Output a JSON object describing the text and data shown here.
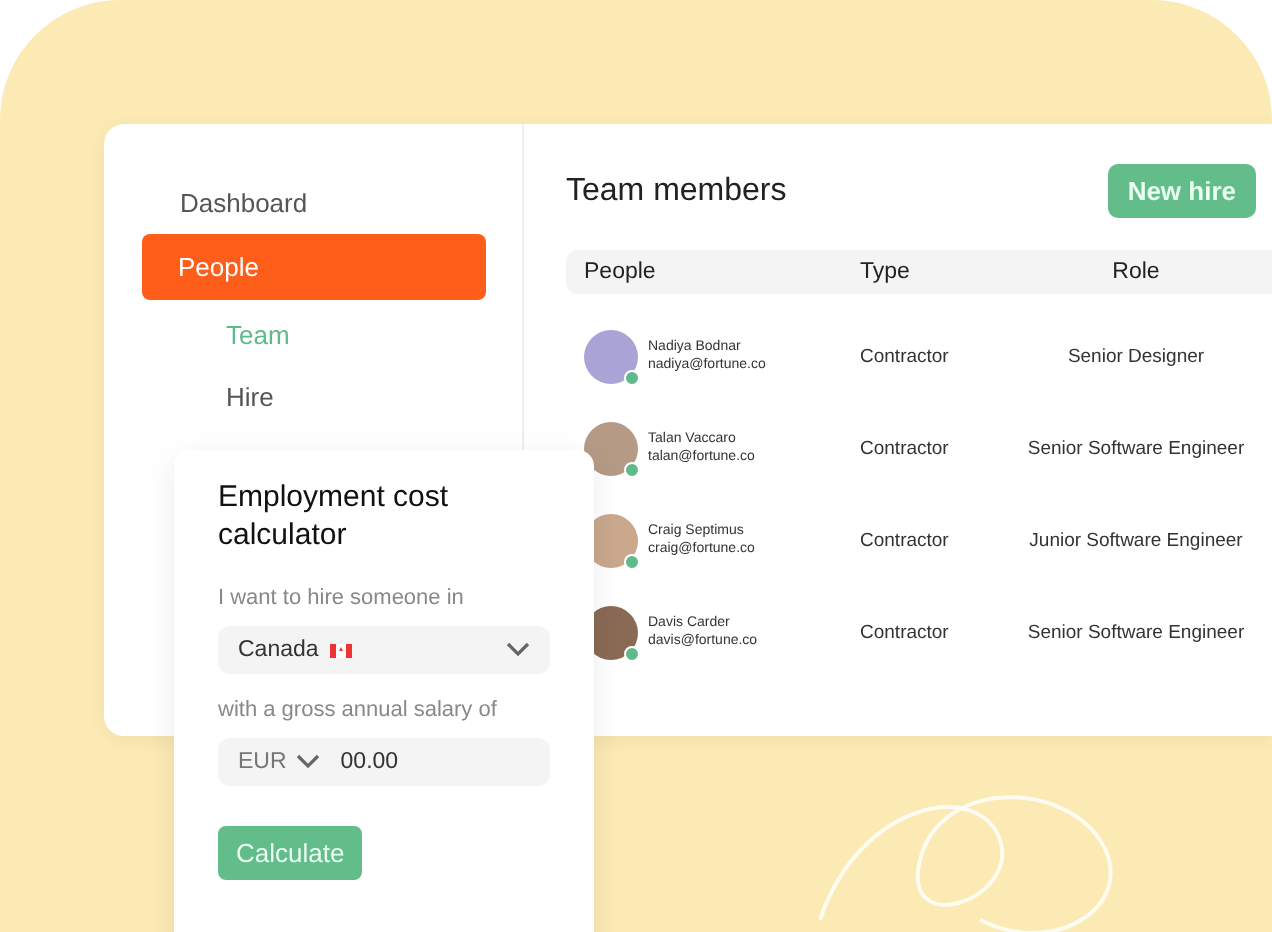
{
  "sidebar": {
    "items": [
      {
        "label": "Dashboard",
        "selected": false
      },
      {
        "label": "People",
        "selected": true,
        "children": [
          {
            "label": "Team",
            "selected": true
          },
          {
            "label": "Hire",
            "selected": false
          }
        ]
      }
    ]
  },
  "team": {
    "title": "Team members",
    "new_hire_button": "New hire",
    "columns": [
      "People",
      "Type",
      "Role"
    ],
    "rows": [
      {
        "name": "Nadiya Bodnar",
        "email": "nadiya@fortune.co",
        "type": "Contractor",
        "role": "Senior Designer"
      },
      {
        "name": "Talan Vaccaro",
        "email": "talan@fortune.co",
        "type": "Contractor",
        "role": "Senior Software Engineer"
      },
      {
        "name": "Craig Septimus",
        "email": "craig@fortune.co",
        "type": "Contractor",
        "role": "Junior Software Engineer"
      },
      {
        "name": "Davis Carder",
        "email": "davis@fortune.co",
        "type": "Contractor",
        "role": "Senior Software Engineer"
      }
    ]
  },
  "calculator": {
    "title": "Employment cost calculator",
    "country_label": "I want to hire someone in",
    "country": "Canada",
    "salary_label": "with a gross annual salary of",
    "currency": "EUR",
    "amount": "00.00",
    "button": "Calculate"
  }
}
